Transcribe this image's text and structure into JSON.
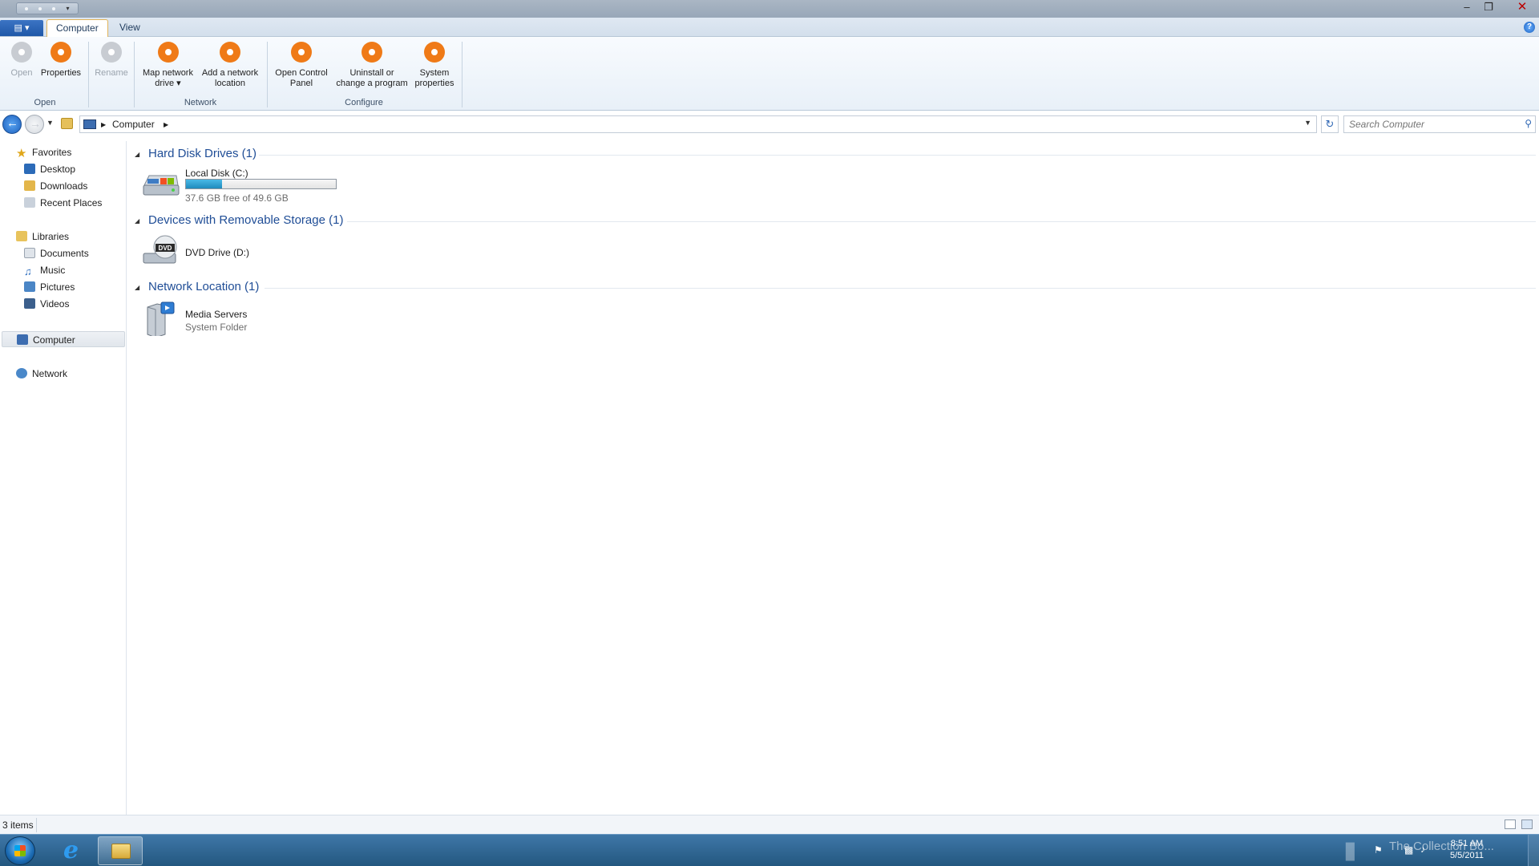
{
  "tabs": {
    "file": "",
    "computer": "Computer",
    "view": "View"
  },
  "ribbon": {
    "open": "Open",
    "properties": "Properties",
    "rename": "Rename",
    "map_network_drive_1": "Map network",
    "map_network_drive_2": "drive ▾",
    "add_network_location_1": "Add a network",
    "add_network_location_2": "location",
    "open_control_panel_1": "Open Control",
    "open_control_panel_2": "Panel",
    "uninstall_1": "Uninstall or",
    "uninstall_2": "change a program",
    "system_properties_1": "System",
    "system_properties_2": "properties",
    "group_open": "Open",
    "group_network": "Network",
    "group_configure": "Configure"
  },
  "address": {
    "crumb_root": "▶",
    "crumb": "Computer",
    "crumb_arrow": "▶",
    "search_placeholder": "Search Computer"
  },
  "nav": {
    "favorites": "Favorites",
    "desktop": "Desktop",
    "downloads": "Downloads",
    "recent_places": "Recent Places",
    "libraries": "Libraries",
    "documents": "Documents",
    "music": "Music",
    "pictures": "Pictures",
    "videos": "Videos",
    "computer": "Computer",
    "network": "Network"
  },
  "groups": {
    "hdd": "Hard Disk Drives (1)",
    "removable": "Devices with Removable Storage (1)",
    "network": "Network Location (1)"
  },
  "items": {
    "local_disk_name": "Local Disk (C:)",
    "local_disk_space": "37.6 GB free of 49.6 GB",
    "local_disk_used_fraction": 0.242,
    "dvd_name": "DVD Drive (D:)",
    "dvd_label": "DVD",
    "media_name": "Media Servers",
    "media_sub": "System Folder"
  },
  "status": {
    "count": "3 items"
  },
  "taskbar": {
    "time": "8:51 AM",
    "date": "5/5/2011",
    "watermark": "The Collection Bo..."
  },
  "colors": {
    "accent_orange": "#ef7a17",
    "link_blue": "#1f4d96",
    "disk_bar": "#1f8bbd"
  }
}
